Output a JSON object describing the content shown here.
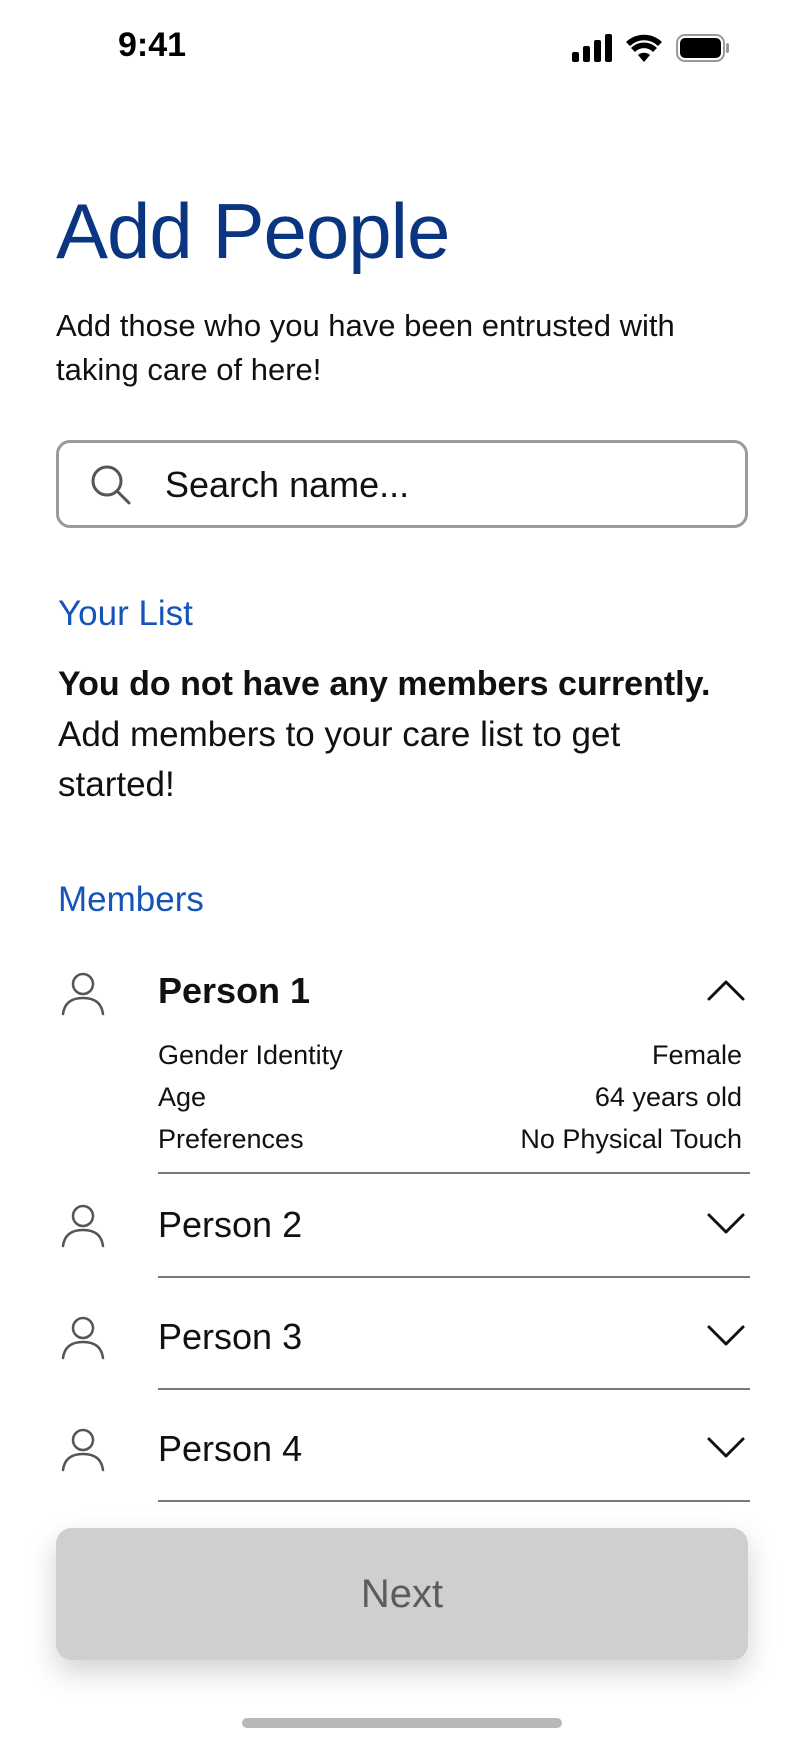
{
  "status_bar": {
    "time": "9:41",
    "icons": [
      "signal-icon",
      "wifi-icon",
      "battery-icon"
    ]
  },
  "header": {
    "title": "Add People",
    "subtitle": "Add those who you have been entrusted with taking care of here!"
  },
  "search": {
    "placeholder": "Search name...",
    "value": ""
  },
  "your_list": {
    "heading": "Your List",
    "empty_bold": "You do not have any members currently.",
    "empty_text": "Add members to your care list to get started!"
  },
  "members": {
    "heading": "Members",
    "items": [
      {
        "name": "Person 1",
        "expanded": true,
        "details": [
          {
            "label": "Gender Identity",
            "value": "Female"
          },
          {
            "label": "Age",
            "value": "64 years old"
          },
          {
            "label": "Preferences",
            "value": "No Physical Touch"
          }
        ]
      },
      {
        "name": "Person 2",
        "expanded": false
      },
      {
        "name": "Person 3",
        "expanded": false
      },
      {
        "name": "Person 4",
        "expanded": false
      }
    ]
  },
  "footer": {
    "next_label": "Next"
  },
  "colors": {
    "title": "#0a3580",
    "section_heading": "#1554b8",
    "button_disabled_bg": "#cfcfcf",
    "button_disabled_text": "#5c5c5c"
  }
}
